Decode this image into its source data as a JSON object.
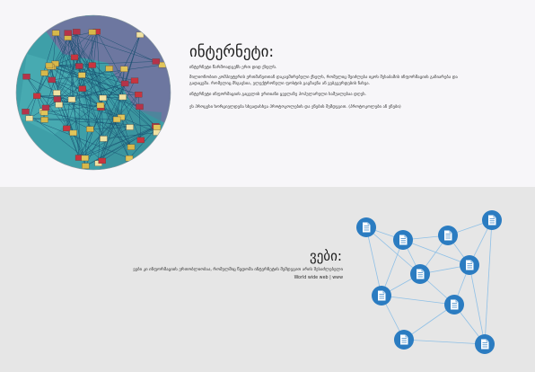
{
  "internet": {
    "title": "ინტერნეტი:",
    "line1": "ინტერნეტი წარმოადგენს ერთ დიდ ქსელს.",
    "line2": "მილიონობით კომპიუტერის ერთმანეთთან დაკავშირებული ქსელს, რომელიც შეიძლება იყოს შესაბამის ინფორმაციის გაზიარება და",
    "line3": "გადაცემა. რომელიც მსგავსია, ელექტრონული ფოსტის გაგზავნა ან ვებგვერდების ნახვა.",
    "line4": "ინტერნეტი ინფორმაციის გაცვლის ერთიანი ყველაზე პოპულარული საშუალებაა დღეს.",
    "line5": "ეს პროცესი ხორციელდება სხვადასხვა პროტოკოლების და ენების შემდეგით. (პროტოკოლები ან ენები)"
  },
  "web": {
    "title": "ვები:",
    "line1": "ვები კი ინფორმაციის ერთობლიობაა, რომელშიც წვდომა ინტერნეტის შემდეგით არის შესაძლებელი",
    "line2": "World wide web | www"
  },
  "colors": {
    "node": "#2b7cc1",
    "link": "#8fc0e6",
    "globe": "#3e9fa8"
  },
  "icons": {
    "node": "document-icon"
  }
}
